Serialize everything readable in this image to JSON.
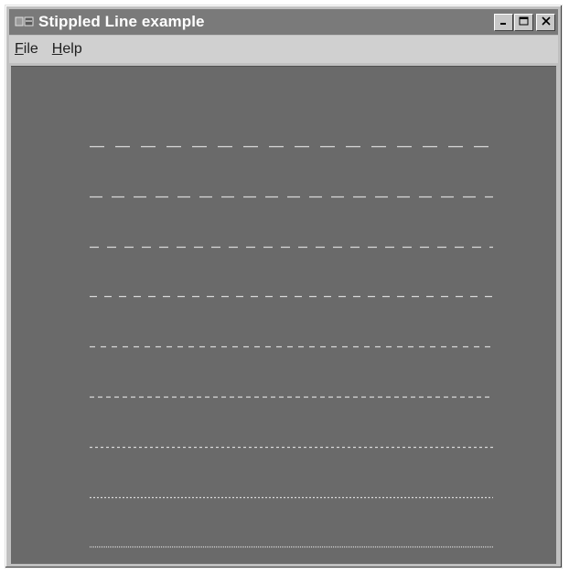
{
  "window": {
    "title": "Stippled Line example",
    "title_icon": "app-window-icon",
    "buttons": [
      "minimize-icon",
      "maximize-icon",
      "close-icon"
    ]
  },
  "menu": {
    "items": [
      {
        "label": "File",
        "accel": "F",
        "rest": "ile"
      },
      {
        "label": "Help",
        "accel": "H",
        "rest": "elp"
      }
    ]
  },
  "canvas": {
    "background": "#6a6a6a",
    "line_color": "#d8d8d8",
    "stipple_lines": [
      {
        "dash": 16,
        "gap": 12
      },
      {
        "dash": 14,
        "gap": 10
      },
      {
        "dash": 10,
        "gap": 9
      },
      {
        "dash": 8,
        "gap": 8
      },
      {
        "dash": 6,
        "gap": 6
      },
      {
        "dash": 5,
        "gap": 4
      },
      {
        "dash": 3,
        "gap": 3
      },
      {
        "dash": 2,
        "gap": 2
      },
      {
        "dash": 1,
        "gap": 1
      }
    ]
  },
  "colors": {
    "titlebar": "#7a7a7a",
    "menubar": "#d0d0d0",
    "frame": "#c0c0c0"
  }
}
